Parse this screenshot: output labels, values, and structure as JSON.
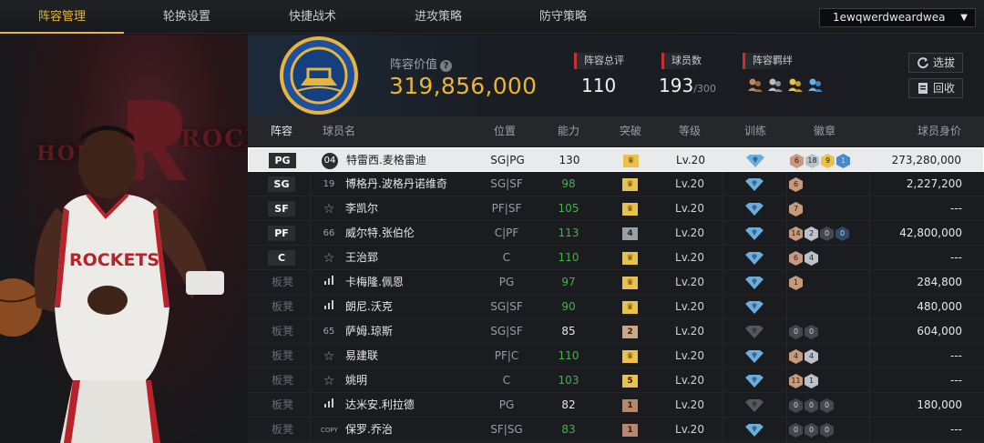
{
  "nav": {
    "tabs": [
      "阵容管理",
      "轮换设置",
      "快捷战术",
      "进攻策略",
      "防守策略"
    ],
    "active": 0,
    "account": "1ewqwerdweardwea"
  },
  "summary": {
    "value_label": "阵容价值",
    "value": "319,856,000",
    "rating_label": "阵容总评",
    "rating": "110",
    "count_label": "球员数",
    "count": "193",
    "count_max": "/300",
    "bond_label": "阵容羁绊",
    "pick_label": "选拔",
    "recycle_label": "回收"
  },
  "table": {
    "headers": [
      "阵容",
      "球员名",
      "位置",
      "能力",
      "突破",
      "等级",
      "训练",
      "徽章",
      "球员身价"
    ],
    "rows": [
      {
        "slot": "PG",
        "num": "04",
        "num_type": "jersey",
        "name": "特雷西.麦格雷迪",
        "pos": "SG|PG",
        "ability": "130",
        "ability_color": "white",
        "break": "crown",
        "level": "Lv.20",
        "train": "blue",
        "badges": [
          [
            "6",
            "bronze"
          ],
          [
            "18",
            "silver"
          ],
          [
            "9",
            "gold"
          ],
          [
            "1",
            "blue"
          ]
        ],
        "price": "273,280,000",
        "selected": true
      },
      {
        "slot": "SG",
        "num": "19",
        "num_type": "plain",
        "name": "博格丹.波格丹诺维奇",
        "pos": "SG|SF",
        "ability": "98",
        "ability_color": "green",
        "break": "crown",
        "level": "Lv.20",
        "train": "blue",
        "badges": [
          [
            "6",
            "bronze"
          ]
        ],
        "price": "2,227,200"
      },
      {
        "slot": "SF",
        "num": "☆",
        "num_type": "star",
        "name": "李凯尔",
        "pos": "PF|SF",
        "ability": "105",
        "ability_color": "green",
        "break": "crown",
        "level": "Lv.20",
        "train": "blue",
        "badges": [
          [
            "7",
            "bronze"
          ]
        ],
        "price": "---"
      },
      {
        "slot": "PF",
        "num": "66",
        "num_type": "plain",
        "name": "威尔特.张伯伦",
        "pos": "C|PF",
        "ability": "113",
        "ability_color": "green",
        "break": "4",
        "level": "Lv.20",
        "train": "blue",
        "badges": [
          [
            "14",
            "bronze"
          ],
          [
            "2",
            "silver"
          ],
          [
            "0",
            "dark"
          ],
          [
            "0",
            "darkblue"
          ]
        ],
        "price": "42,800,000"
      },
      {
        "slot": "C",
        "num": "☆",
        "num_type": "star",
        "name": "王治郅",
        "pos": "C",
        "ability": "110",
        "ability_color": "green",
        "break": "crown",
        "level": "Lv.20",
        "train": "blue",
        "badges": [
          [
            "6",
            "bronze"
          ],
          [
            "4",
            "silver"
          ]
        ],
        "price": "---"
      },
      {
        "slot": "板凳",
        "num": "bars",
        "num_type": "bars",
        "name": "卡梅隆.佩恩",
        "pos": "PG",
        "ability": "97",
        "ability_color": "green",
        "break": "crown",
        "level": "Lv.20",
        "train": "blue",
        "badges": [
          [
            "1",
            "bronze"
          ]
        ],
        "price": "284,800"
      },
      {
        "slot": "板凳",
        "num": "bars",
        "num_type": "bars",
        "name": "朗尼.沃克",
        "pos": "SG|SF",
        "ability": "90",
        "ability_color": "green",
        "break": "crown",
        "level": "Lv.20",
        "train": "blue",
        "badges": [],
        "price": "480,000"
      },
      {
        "slot": "板凳",
        "num": "65",
        "num_type": "plain",
        "name": "萨姆.琼斯",
        "pos": "SG|SF",
        "ability": "85",
        "ability_color": "white",
        "break": "2",
        "level": "Lv.20",
        "train": "gray",
        "badges": [
          [
            "0",
            "dark"
          ],
          [
            "0",
            "dark"
          ]
        ],
        "price": "604,000"
      },
      {
        "slot": "板凳",
        "num": "☆",
        "num_type": "star",
        "name": "易建联",
        "pos": "PF|C",
        "ability": "110",
        "ability_color": "green",
        "break": "crown",
        "level": "Lv.20",
        "train": "blue",
        "badges": [
          [
            "4",
            "bronze"
          ],
          [
            "4",
            "silver"
          ]
        ],
        "price": "---"
      },
      {
        "slot": "板凳",
        "num": "☆",
        "num_type": "star",
        "name": "姚明",
        "pos": "C",
        "ability": "103",
        "ability_color": "green",
        "break": "5",
        "level": "Lv.20",
        "train": "blue",
        "badges": [
          [
            "11",
            "bronze"
          ],
          [
            "1",
            "silver"
          ]
        ],
        "price": "---"
      },
      {
        "slot": "板凳",
        "num": "bars",
        "num_type": "bars",
        "name": "达米安.利拉德",
        "pos": "PG",
        "ability": "82",
        "ability_color": "white",
        "break": "1",
        "level": "Lv.20",
        "train": "gray",
        "badges": [
          [
            "0",
            "dark"
          ],
          [
            "0",
            "dark"
          ],
          [
            "0",
            "dark"
          ]
        ],
        "price": "180,000"
      },
      {
        "slot": "板凳",
        "num": "COPY",
        "num_type": "copy",
        "name": "保罗.乔治",
        "pos": "SF|SG",
        "ability": "83",
        "ability_color": "green",
        "break": "1",
        "level": "Lv.20",
        "train": "blue",
        "badges": [
          [
            "0",
            "dark"
          ],
          [
            "0",
            "dark"
          ],
          [
            "0",
            "dark"
          ]
        ],
        "price": "---"
      }
    ]
  },
  "art": {
    "jersey_text": "ROCKETS",
    "bg_text_left": "HOUS",
    "bg_text_right": "ROCK"
  },
  "colors": {
    "accent": "#e8b53c",
    "green": "#45b14b",
    "red": "#c8302e"
  }
}
